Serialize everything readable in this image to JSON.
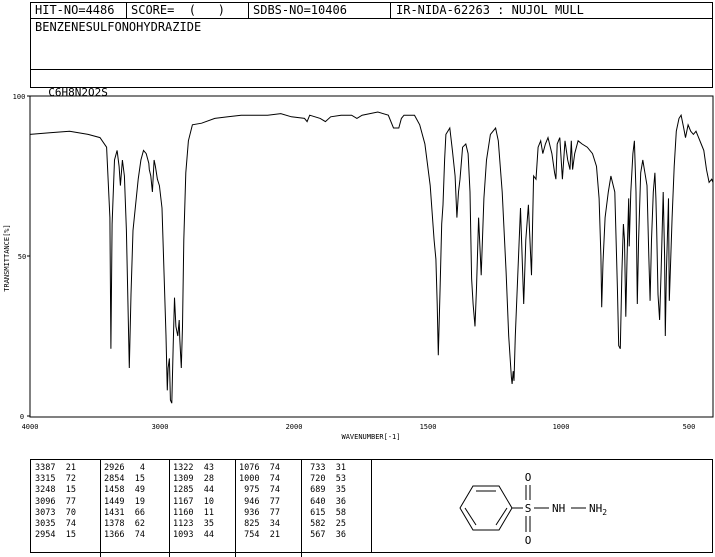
{
  "header": {
    "hit_no": "HIT-NO=4486",
    "score": "SCORE=  (   )",
    "sdbs_no": "SDBS-NO=10406",
    "ir_id": "IR-NIDA-62263 : NUJOL MULL",
    "compound_name": "BENZENESULFONOHYDRAZIDE",
    "formula": "C6H8N2O2S"
  },
  "chart_data": {
    "type": "line",
    "title": "",
    "xlabel": "WAVENUMBER[-1]",
    "ylabel": "TRANSMITTANCE[%]",
    "xlim": [
      4000,
      400
    ],
    "ylim": [
      0,
      100
    ],
    "x_ticks": [
      "4000",
      "3000",
      "2000",
      "1500",
      "1000",
      "500"
    ],
    "y_ticks": [
      "100",
      "50",
      "0"
    ],
    "series": [
      {
        "points": [
          [
            4000,
            88
          ],
          [
            3850,
            88.5
          ],
          [
            3700,
            89
          ],
          [
            3560,
            88
          ],
          [
            3470,
            87
          ],
          [
            3420,
            84
          ],
          [
            3395,
            62
          ],
          [
            3387,
            21
          ],
          [
            3378,
            60
          ],
          [
            3360,
            80
          ],
          [
            3340,
            83
          ],
          [
            3325,
            78
          ],
          [
            3315,
            72
          ],
          [
            3300,
            80
          ],
          [
            3285,
            75
          ],
          [
            3270,
            58
          ],
          [
            3255,
            30
          ],
          [
            3248,
            15
          ],
          [
            3235,
            38
          ],
          [
            3220,
            58
          ],
          [
            3200,
            66
          ],
          [
            3180,
            74
          ],
          [
            3160,
            80
          ],
          [
            3140,
            83
          ],
          [
            3120,
            82
          ],
          [
            3100,
            79
          ],
          [
            3096,
            77
          ],
          [
            3085,
            75
          ],
          [
            3073,
            70
          ],
          [
            3060,
            80
          ],
          [
            3050,
            78
          ],
          [
            3035,
            74
          ],
          [
            3020,
            72
          ],
          [
            3000,
            65
          ],
          [
            2985,
            45
          ],
          [
            2970,
            25
          ],
          [
            2960,
            8
          ],
          [
            2954,
            15
          ],
          [
            2944,
            18
          ],
          [
            2936,
            5
          ],
          [
            2926,
            4
          ],
          [
            2915,
            22
          ],
          [
            2905,
            37
          ],
          [
            2895,
            28
          ],
          [
            2880,
            25
          ],
          [
            2870,
            30
          ],
          [
            2865,
            24
          ],
          [
            2854,
            15
          ],
          [
            2845,
            28
          ],
          [
            2835,
            55
          ],
          [
            2820,
            76
          ],
          [
            2800,
            86
          ],
          [
            2770,
            91
          ],
          [
            2700,
            91.5
          ],
          [
            2600,
            93
          ],
          [
            2500,
            93.5
          ],
          [
            2400,
            94
          ],
          [
            2200,
            94
          ],
          [
            2100,
            94.5
          ],
          [
            2020,
            93.5
          ],
          [
            1960,
            93
          ],
          [
            1950,
            92
          ],
          [
            1940,
            94
          ],
          [
            1900,
            93
          ],
          [
            1880,
            92
          ],
          [
            1860,
            93.5
          ],
          [
            1820,
            94
          ],
          [
            1780,
            94
          ],
          [
            1760,
            93
          ],
          [
            1740,
            94
          ],
          [
            1680,
            95
          ],
          [
            1640,
            94
          ],
          [
            1620,
            90
          ],
          [
            1600,
            90
          ],
          [
            1590,
            93
          ],
          [
            1580,
            94
          ],
          [
            1560,
            94
          ],
          [
            1540,
            94
          ],
          [
            1520,
            91
          ],
          [
            1500,
            85
          ],
          [
            1480,
            72
          ],
          [
            1465,
            55
          ],
          [
            1458,
            49
          ],
          [
            1453,
            35
          ],
          [
            1449,
            19
          ],
          [
            1442,
            40
          ],
          [
            1436,
            60
          ],
          [
            1431,
            66
          ],
          [
            1425,
            80
          ],
          [
            1420,
            88
          ],
          [
            1405,
            90
          ],
          [
            1395,
            83
          ],
          [
            1385,
            75
          ],
          [
            1378,
            62
          ],
          [
            1372,
            70
          ],
          [
            1366,
            74
          ],
          [
            1356,
            84
          ],
          [
            1344,
            85
          ],
          [
            1335,
            82
          ],
          [
            1328,
            70
          ],
          [
            1322,
            43
          ],
          [
            1316,
            35
          ],
          [
            1309,
            28
          ],
          [
            1303,
            40
          ],
          [
            1295,
            62
          ],
          [
            1285,
            44
          ],
          [
            1275,
            68
          ],
          [
            1265,
            80
          ],
          [
            1250,
            88
          ],
          [
            1230,
            90
          ],
          [
            1220,
            86
          ],
          [
            1205,
            70
          ],
          [
            1190,
            45
          ],
          [
            1180,
            25
          ],
          [
            1170,
            12
          ],
          [
            1167,
            10
          ],
          [
            1163,
            14
          ],
          [
            1160,
            11
          ],
          [
            1155,
            25
          ],
          [
            1145,
            45
          ],
          [
            1135,
            65
          ],
          [
            1123,
            35
          ],
          [
            1115,
            55
          ],
          [
            1105,
            66
          ],
          [
            1093,
            44
          ],
          [
            1085,
            75
          ],
          [
            1076,
            74
          ],
          [
            1068,
            84
          ],
          [
            1058,
            86
          ],
          [
            1050,
            82
          ],
          [
            1040,
            85
          ],
          [
            1030,
            87
          ],
          [
            1015,
            82
          ],
          [
            1005,
            76
          ],
          [
            1000,
            74
          ],
          [
            995,
            85
          ],
          [
            985,
            87
          ],
          [
            975,
            74
          ],
          [
            965,
            86
          ],
          [
            955,
            80
          ],
          [
            946,
            77
          ],
          [
            941,
            86
          ],
          [
            936,
            77
          ],
          [
            928,
            82
          ],
          [
            915,
            86
          ],
          [
            900,
            85
          ],
          [
            880,
            84
          ],
          [
            860,
            82
          ],
          [
            845,
            78
          ],
          [
            835,
            68
          ],
          [
            828,
            50
          ],
          [
            825,
            34
          ],
          [
            820,
            48
          ],
          [
            812,
            62
          ],
          [
            800,
            70
          ],
          [
            790,
            75
          ],
          [
            775,
            70
          ],
          [
            765,
            40
          ],
          [
            760,
            22
          ],
          [
            754,
            21
          ],
          [
            748,
            45
          ],
          [
            742,
            60
          ],
          [
            738,
            55
          ],
          [
            733,
            31
          ],
          [
            728,
            50
          ],
          [
            722,
            68
          ],
          [
            720,
            53
          ],
          [
            714,
            70
          ],
          [
            706,
            82
          ],
          [
            700,
            86
          ],
          [
            694,
            70
          ],
          [
            689,
            35
          ],
          [
            684,
            55
          ],
          [
            676,
            76
          ],
          [
            668,
            80
          ],
          [
            660,
            76
          ],
          [
            652,
            72
          ],
          [
            645,
            50
          ],
          [
            640,
            36
          ],
          [
            635,
            55
          ],
          [
            628,
            70
          ],
          [
            622,
            76
          ],
          [
            618,
            68
          ],
          [
            615,
            58
          ],
          [
            610,
            38
          ],
          [
            604,
            30
          ],
          [
            598,
            45
          ],
          [
            590,
            70
          ],
          [
            585,
            50
          ],
          [
            582,
            25
          ],
          [
            578,
            45
          ],
          [
            570,
            68
          ],
          [
            567,
            36
          ],
          [
            563,
            45
          ],
          [
            556,
            62
          ],
          [
            548,
            78
          ],
          [
            540,
            89
          ],
          [
            530,
            93
          ],
          [
            522,
            94
          ],
          [
            512,
            90
          ],
          [
            505,
            87
          ],
          [
            495,
            91
          ],
          [
            485,
            89
          ],
          [
            475,
            88
          ],
          [
            465,
            89
          ],
          [
            455,
            87
          ],
          [
            445,
            85
          ],
          [
            435,
            83
          ],
          [
            425,
            77
          ],
          [
            415,
            73
          ],
          [
            405,
            74
          ],
          [
            400,
            73
          ]
        ]
      }
    ],
    "peak_table": [
      [
        "3387",
        "21"
      ],
      [
        "3315",
        "72"
      ],
      [
        "3248",
        "15"
      ],
      [
        "3096",
        "77"
      ],
      [
        "3073",
        "70"
      ],
      [
        "3035",
        "74"
      ],
      [
        "2954",
        "15"
      ],
      [
        "2926",
        "4"
      ],
      [
        "2854",
        "15"
      ],
      [
        "1458",
        "49"
      ],
      [
        "1449",
        "19"
      ],
      [
        "1431",
        "66"
      ],
      [
        "1378",
        "62"
      ],
      [
        "1366",
        "74"
      ],
      [
        "1322",
        "43"
      ],
      [
        "1309",
        "28"
      ],
      [
        "1285",
        "44"
      ],
      [
        "1167",
        "10"
      ],
      [
        "1160",
        "11"
      ],
      [
        "1123",
        "35"
      ],
      [
        "1093",
        "44"
      ],
      [
        "1076",
        "74"
      ],
      [
        "1000",
        "74"
      ],
      [
        "975",
        "74"
      ],
      [
        "946",
        "77"
      ],
      [
        "936",
        "77"
      ],
      [
        "825",
        "34"
      ],
      [
        "754",
        "21"
      ],
      [
        "733",
        "31"
      ],
      [
        "720",
        "53"
      ],
      [
        "689",
        "35"
      ],
      [
        "640",
        "36"
      ],
      [
        "615",
        "58"
      ],
      [
        "582",
        "25"
      ],
      [
        "567",
        "36"
      ]
    ]
  },
  "structure": {
    "atom_o_top": "O",
    "atom_o_bottom": "O",
    "atom_s": "S",
    "group_nh": "NH",
    "group_nh2_base": "NH",
    "group_nh2_sub": "2"
  }
}
